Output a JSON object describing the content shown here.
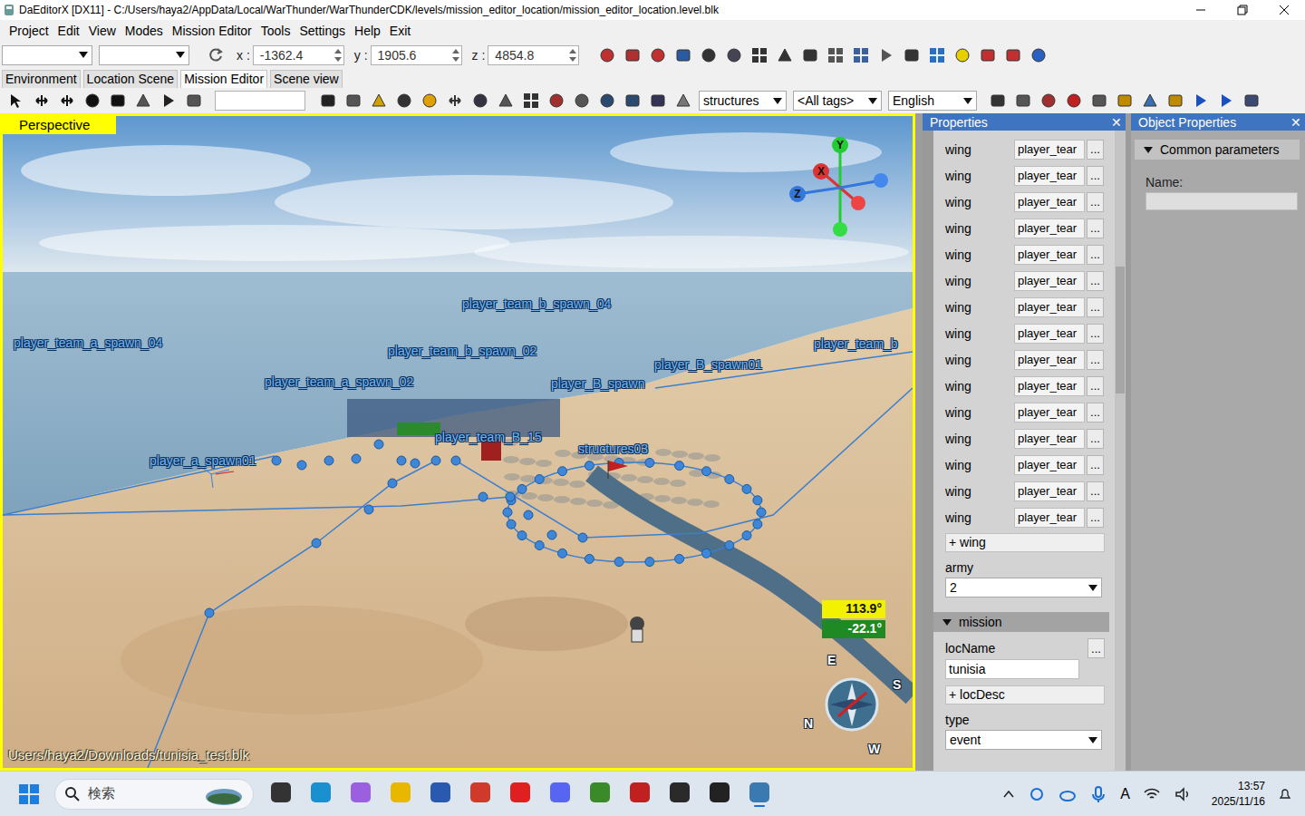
{
  "window": {
    "title": "DaEditorX [DX11] - C:/Users/haya2/AppData/Local/WarThunder/WarThunderCDK/levels/mission_editor_location/mission_editor_location.level.blk"
  },
  "menu": [
    "Project",
    "Edit",
    "View",
    "Modes",
    "Mission Editor",
    "Tools",
    "Settings",
    "Help",
    "Exit"
  ],
  "toolbar": {
    "coords": [
      {
        "axis": "x :",
        "value": "-1362.4"
      },
      {
        "axis": "y :",
        "value": "1905.6"
      },
      {
        "axis": "z :",
        "value": "4854.8"
      }
    ]
  },
  "tabs": [
    {
      "label": "Environment",
      "selected": false
    },
    {
      "label": "Location Scene",
      "selected": false
    },
    {
      "label": "Mission Editor",
      "selected": true
    },
    {
      "label": "Scene view",
      "selected": false
    }
  ],
  "filters": {
    "category": "structures",
    "tags": "<All tags>",
    "language": "English"
  },
  "viewport": {
    "label": "Perspective",
    "file": "Users/haya2/Downloads/tunisia_test.blk",
    "angles": [
      {
        "value": "113.9°",
        "color": "#f2f200"
      },
      {
        "value": "-22.1°",
        "color": "#1f8a24"
      }
    ],
    "axes": [
      {
        "label": "Y",
        "color": "#22cc33"
      },
      {
        "label": "X",
        "color": "#dd3333"
      },
      {
        "label": "Z",
        "color": "#3377dd"
      }
    ],
    "compass": [
      "E",
      "S",
      "N",
      "W"
    ],
    "objects": [
      {
        "label": "player_team_b_spawn_04"
      },
      {
        "label": "player_team_a_spawn_04"
      },
      {
        "label": "player_team_b_spawn_02"
      },
      {
        "label": "player_team_a_spawn_02"
      },
      {
        "label": "player_B_spawn01"
      },
      {
        "label": "player_team_b"
      },
      {
        "label": "player_B_spawn"
      },
      {
        "label": "player_a_spawn01"
      },
      {
        "label": "structures03"
      },
      {
        "label": "player_team_B_15"
      }
    ]
  },
  "properties": {
    "title": "Properties",
    "close": "✕",
    "wings": [
      {
        "label": "wing",
        "value": "player_tear",
        "button": "..."
      },
      {
        "label": "wing",
        "value": "player_tear",
        "button": "..."
      },
      {
        "label": "wing",
        "value": "player_tear",
        "button": "..."
      },
      {
        "label": "wing",
        "value": "player_tear",
        "button": "..."
      },
      {
        "label": "wing",
        "value": "player_tear",
        "button": "..."
      },
      {
        "label": "wing",
        "value": "player_tear",
        "button": "..."
      },
      {
        "label": "wing",
        "value": "player_tear",
        "button": "..."
      },
      {
        "label": "wing",
        "value": "player_tear",
        "button": "..."
      },
      {
        "label": "wing",
        "value": "player_tear",
        "button": "..."
      },
      {
        "label": "wing",
        "value": "player_tear",
        "button": "..."
      },
      {
        "label": "wing",
        "value": "player_tear",
        "button": "..."
      },
      {
        "label": "wing",
        "value": "player_tear",
        "button": "..."
      },
      {
        "label": "wing",
        "value": "player_tear",
        "button": "..."
      },
      {
        "label": "wing",
        "value": "player_tear",
        "button": "..."
      },
      {
        "label": "wing",
        "value": "player_tear",
        "button": "..."
      }
    ],
    "add_wing": "+ wing",
    "army": {
      "label": "army",
      "value": "2"
    },
    "mission": {
      "title": "mission",
      "expanded": true,
      "locName": {
        "label": "locName",
        "value": "tunisia",
        "button": "..."
      },
      "add_locDesc": "+ locDesc",
      "type": {
        "label": "type",
        "value": "event"
      }
    }
  },
  "object_properties": {
    "title": "Object Properties",
    "close": "✕",
    "section": {
      "title": "Common parameters",
      "expanded": true
    },
    "name": {
      "label": "Name:",
      "value": ""
    }
  },
  "taskbar": {
    "search": "検索",
    "ime": "A",
    "time": "13:57",
    "date": "2025/11/16"
  }
}
